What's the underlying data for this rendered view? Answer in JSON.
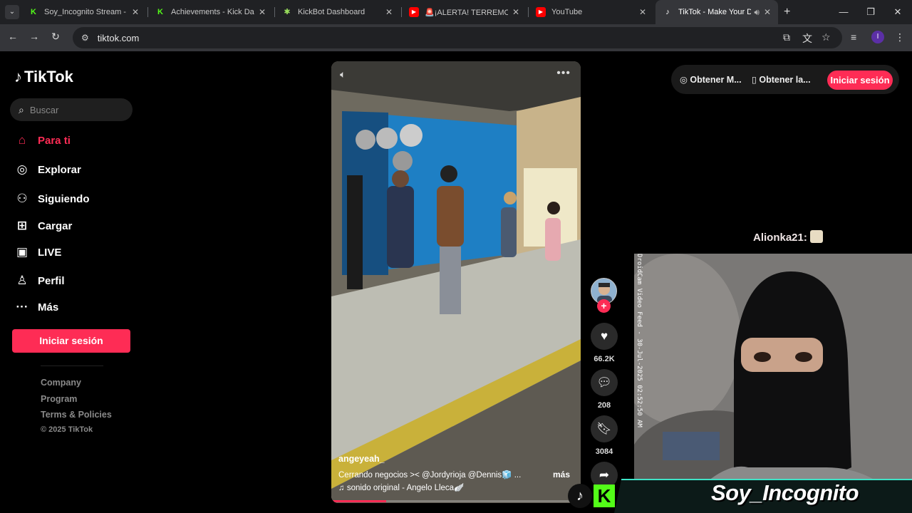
{
  "browser": {
    "tabs": [
      {
        "title": "Soy_Incognito Stream - Wa",
        "favicon": "kick-icon",
        "color": "#53fc18"
      },
      {
        "title": "Achievements - Kick Dashb",
        "favicon": "kick-icon",
        "color": "#53fc18"
      },
      {
        "title": "KickBot Dashboard",
        "favicon": "kickbot-icon",
        "color": "#9be15d"
      },
      {
        "title": "🚨¡ALERTA! TERREMOTO d",
        "favicon": "youtube-icon",
        "color": "#ff0000"
      },
      {
        "title": "YouTube",
        "favicon": "youtube-icon",
        "color": "#ff0000"
      },
      {
        "title": "TikTok - Make Your Da",
        "favicon": "tiktok-icon",
        "color": "#ffffff"
      }
    ],
    "url": "tiktok.com"
  },
  "sidebar": {
    "logo_text": "TikTok",
    "search_placeholder": "Buscar",
    "items": [
      {
        "label": "Para ti",
        "icon": "home-icon"
      },
      {
        "label": "Explorar",
        "icon": "compass-icon"
      },
      {
        "label": "Siguiendo",
        "icon": "following-icon"
      },
      {
        "label": "Cargar",
        "icon": "upload-icon"
      },
      {
        "label": "LIVE",
        "icon": "live-icon"
      },
      {
        "label": "Perfil",
        "icon": "profile-icon"
      },
      {
        "label": "Más",
        "icon": "more-icon"
      }
    ],
    "login_label": "Iniciar sesión",
    "footer_links": [
      "Company",
      "Program",
      "Terms & Policies"
    ],
    "copyright": "© 2025 TikTok"
  },
  "header": {
    "get_coins": "Obtener M...",
    "get_app": "Obtener la...",
    "login_label": "Iniciar sesión"
  },
  "video": {
    "username": "angeyeah_",
    "description": "Cerrando negocios >< @Jordyrioja  @Dennis🧊  ...",
    "more_label": "más",
    "sound": "♫  sonido original - Angelo Lleca🪽",
    "progress": 0.22
  },
  "actions": {
    "likes": "66.2K",
    "comments": "208",
    "saves": "3084"
  },
  "stream": {
    "chat_user": "Alionka21:",
    "cam_timestamp": "DroidCam Video Feed - 30-Jul-2025 02:52:50 AM",
    "streamer_name": "Soy_Incognito"
  },
  "colors": {
    "tiktok_red": "#fe2c55",
    "kick_green": "#53fc18"
  }
}
